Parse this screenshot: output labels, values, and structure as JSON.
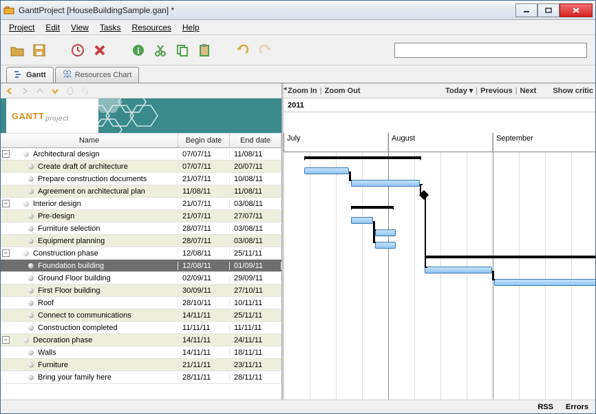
{
  "window": {
    "title": "GanttProject [HouseBuildingSample.gan] *"
  },
  "menu": {
    "project": "Project",
    "edit": "Edit",
    "view": "View",
    "tasks": "Tasks",
    "resources": "Resources",
    "help": "Help"
  },
  "tabs": {
    "gantt": "Gantt",
    "resources": "Resources Chart"
  },
  "columns": {
    "name": "Name",
    "begin": "Begin date",
    "end": "End date"
  },
  "tasks": [
    {
      "name": "Architectural design",
      "begin": "07/07/11",
      "end": "11/08/11",
      "level": 0,
      "exp": true,
      "alt": false
    },
    {
      "name": "Create draft of architecture",
      "begin": "07/07/11",
      "end": "20/07/11",
      "level": 1,
      "alt": true
    },
    {
      "name": "Prepare construction documents",
      "begin": "21/07/11",
      "end": "10/08/11",
      "level": 1,
      "alt": false
    },
    {
      "name": "Agreement on architectural plan",
      "begin": "11/08/11",
      "end": "11/08/11",
      "level": 1,
      "alt": true
    },
    {
      "name": "Interior design",
      "begin": "21/07/11",
      "end": "03/08/11",
      "level": 0,
      "exp": true,
      "alt": false
    },
    {
      "name": "Pre-design",
      "begin": "21/07/11",
      "end": "27/07/11",
      "level": 1,
      "alt": true
    },
    {
      "name": "Furniture selection",
      "begin": "28/07/11",
      "end": "03/08/11",
      "level": 1,
      "alt": false
    },
    {
      "name": "Equipment planning",
      "begin": "28/07/11",
      "end": "03/08/11",
      "level": 1,
      "alt": true
    },
    {
      "name": "Construction phase",
      "begin": "12/08/11",
      "end": "25/11/11",
      "level": 0,
      "exp": true,
      "alt": false
    },
    {
      "name": "Foundation building",
      "begin": "12/08/11",
      "end": "01/09/11",
      "level": 1,
      "alt": true,
      "selected": true
    },
    {
      "name": "Ground Floor building",
      "begin": "02/09/11",
      "end": "29/09/11",
      "level": 1,
      "alt": false
    },
    {
      "name": "First Floor building",
      "begin": "30/09/11",
      "end": "27/10/11",
      "level": 1,
      "alt": true
    },
    {
      "name": "Roof",
      "begin": "28/10/11",
      "end": "10/11/11",
      "level": 1,
      "alt": false
    },
    {
      "name": "Connect to communications",
      "begin": "14/11/11",
      "end": "25/11/11",
      "level": 1,
      "alt": true
    },
    {
      "name": "Construction completed",
      "begin": "11/11/11",
      "end": "11/11/11",
      "level": 1,
      "alt": false
    },
    {
      "name": "Decoration phase",
      "begin": "14/11/11",
      "end": "24/11/11",
      "level": 0,
      "exp": true,
      "alt": true
    },
    {
      "name": "Walls",
      "begin": "14/11/11",
      "end": "18/11/11",
      "level": 1,
      "alt": false
    },
    {
      "name": "Furniture",
      "begin": "21/11/11",
      "end": "23/11/11",
      "level": 1,
      "alt": true
    },
    {
      "name": "Bring your family here",
      "begin": "28/11/11",
      "end": "28/11/11",
      "level": 1,
      "alt": false
    }
  ],
  "timeline": {
    "year": "2011",
    "months": [
      "July",
      "August",
      "September"
    ],
    "zoom_in": "Zoom In",
    "zoom_out": "Zoom Out",
    "today": "Today",
    "previous": "Previous",
    "next": "Next",
    "critic": "Show critic"
  },
  "banner": {
    "logo_main": "GANTT",
    "logo_sub": "project"
  },
  "status": {
    "rss": "RSS",
    "errors": "Errors"
  },
  "chart_data": {
    "type": "gantt",
    "date_range": [
      "2011-07-01",
      "2011-09-30"
    ],
    "tasks": [
      {
        "name": "Architectural design",
        "start": "2011-07-07",
        "end": "2011-08-11",
        "summary": true
      },
      {
        "name": "Create draft of architecture",
        "start": "2011-07-07",
        "end": "2011-07-20"
      },
      {
        "name": "Prepare construction documents",
        "start": "2011-07-21",
        "end": "2011-08-10"
      },
      {
        "name": "Agreement on architectural plan",
        "start": "2011-08-11",
        "end": "2011-08-11",
        "milestone": true
      },
      {
        "name": "Interior design",
        "start": "2011-07-21",
        "end": "2011-08-03",
        "summary": true
      },
      {
        "name": "Pre-design",
        "start": "2011-07-21",
        "end": "2011-07-27"
      },
      {
        "name": "Furniture selection",
        "start": "2011-07-28",
        "end": "2011-08-03"
      },
      {
        "name": "Equipment planning",
        "start": "2011-07-28",
        "end": "2011-08-03"
      },
      {
        "name": "Construction phase",
        "start": "2011-08-12",
        "end": "2011-11-25",
        "summary": true
      },
      {
        "name": "Foundation building",
        "start": "2011-08-12",
        "end": "2011-09-01"
      },
      {
        "name": "Ground Floor building",
        "start": "2011-09-02",
        "end": "2011-09-29"
      }
    ]
  }
}
